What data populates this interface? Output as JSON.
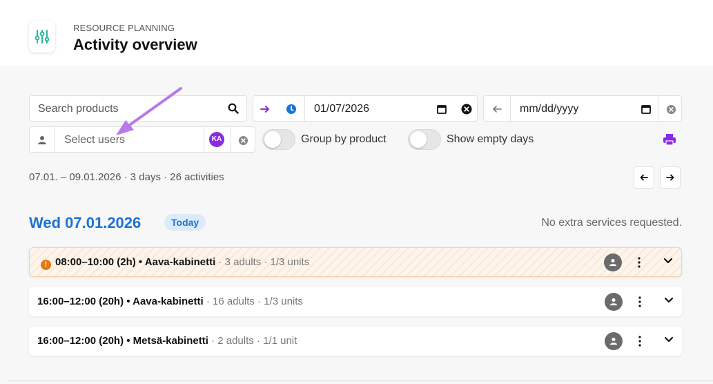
{
  "header": {
    "subtitle": "RESOURCE PLANNING",
    "title": "Activity overview"
  },
  "filters": {
    "search_placeholder": "Search products",
    "date_from": "01/07/2026",
    "date_to_placeholder": "mm/dd/yyyy",
    "users_placeholder": "Select users",
    "user_badge": "KA",
    "group_by_product_label": "Group by product",
    "group_by_product_on": false,
    "show_empty_days_label": "Show empty days",
    "show_empty_days_on": false
  },
  "summary": "07.01. – 09.01.2026 · 3 days · 26 activities",
  "day": {
    "title": "Wed 07.01.2026",
    "badge": "Today",
    "extra": "No extra services requested."
  },
  "activities": [
    {
      "warning": true,
      "time": "08:00–10:00 (2h)",
      "room": "Aava-kabinetti",
      "details": "3 adults · 1/3 units"
    },
    {
      "warning": false,
      "time": "16:00–12:00 (20h)",
      "room": "Aava-kabinetti",
      "details": "16 adults · 1/3 units"
    },
    {
      "warning": false,
      "time": "16:00–12:00 (20h)",
      "room": "Metsä-kabinetti",
      "details": "2 adults · 1/1 unit"
    }
  ],
  "colors": {
    "accent_blue": "#1a73d6",
    "accent_purple": "#8a2be2",
    "logo_teal": "#2bb3a0",
    "warning_orange": "#e8760c"
  }
}
